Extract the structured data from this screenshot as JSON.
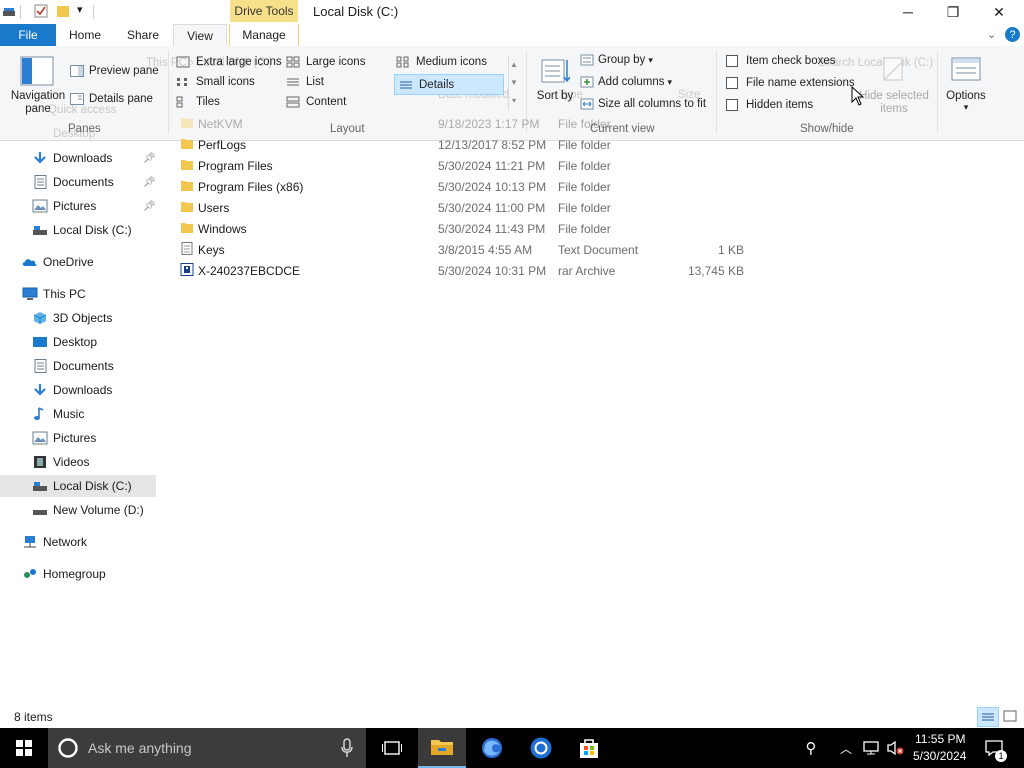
{
  "window": {
    "title": "Local Disk (C:)",
    "context_tab": "Drive Tools",
    "minimize_glyph": "─",
    "restore_glyph": "❐",
    "close_glyph": "✕"
  },
  "ribbon_tabs": {
    "file": "File",
    "home": "Home",
    "share": "Share",
    "view": "View",
    "manage": "Manage"
  },
  "ribbon": {
    "panes": {
      "navigation_pane": "Navigation pane",
      "preview_pane": "Preview pane",
      "details_pane": "Details pane",
      "group_label": "Panes"
    },
    "layout": {
      "extra_large_icons": "Extra large icons",
      "large_icons": "Large icons",
      "medium_icons": "Medium icons",
      "small_icons": "Small icons",
      "list": "List",
      "details": "Details",
      "tiles": "Tiles",
      "content": "Content",
      "group_label": "Layout"
    },
    "current_view": {
      "sort_by": "Sort by",
      "group_by": "Group by",
      "add_columns": "Add columns",
      "size_all_columns": "Size all columns to fit",
      "group_label": "Current view"
    },
    "show_hide": {
      "item_check_boxes": "Item check boxes",
      "file_name_extensions": "File name extensions",
      "hidden_items": "Hidden items",
      "hide_selected_items": "Hide selected items",
      "group_label": "Show/hide"
    },
    "options": "Options",
    "ghost": {
      "address": "This PC › Local Disk (C:)",
      "search": "Search Local Disk (C:)",
      "quick_access": "Quick access",
      "desktop": "Desktop",
      "col_date": "Date modified",
      "col_type": "Type",
      "col_size": "Size"
    }
  },
  "nav": {
    "quick_access": [
      {
        "label": "Downloads",
        "icon": "download-arrow-icon",
        "pinned": true
      },
      {
        "label": "Documents",
        "icon": "documents-icon",
        "pinned": true
      },
      {
        "label": "Pictures",
        "icon": "pictures-icon",
        "pinned": true
      },
      {
        "label": "Local Disk (C:)",
        "icon": "drive-icon",
        "pinned": false
      }
    ],
    "onedrive": "OneDrive",
    "this_pc": "This PC",
    "this_pc_items": [
      {
        "label": "3D Objects",
        "icon": "cube-icon"
      },
      {
        "label": "Desktop",
        "icon": "desktop-icon"
      },
      {
        "label": "Documents",
        "icon": "documents-icon"
      },
      {
        "label": "Downloads",
        "icon": "download-arrow-icon"
      },
      {
        "label": "Music",
        "icon": "music-note-icon"
      },
      {
        "label": "Pictures",
        "icon": "pictures-icon"
      },
      {
        "label": "Videos",
        "icon": "film-icon"
      },
      {
        "label": "Local Disk (C:)",
        "icon": "drive-icon",
        "selected": true
      },
      {
        "label": "New Volume (D:)",
        "icon": "drive-icon"
      }
    ],
    "network": "Network",
    "homegroup": "Homegroup"
  },
  "files": [
    {
      "name": "NetKVM",
      "date": "9/18/2023 1:17 PM",
      "type": "File folder",
      "size": "",
      "icon": "folder-icon",
      "faded": true
    },
    {
      "name": "PerfLogs",
      "date": "12/13/2017 8:52 PM",
      "type": "File folder",
      "size": "",
      "icon": "folder-icon"
    },
    {
      "name": "Program Files",
      "date": "5/30/2024 11:21 PM",
      "type": "File folder",
      "size": "",
      "icon": "folder-icon"
    },
    {
      "name": "Program Files (x86)",
      "date": "5/30/2024 10:13 PM",
      "type": "File folder",
      "size": "",
      "icon": "folder-icon"
    },
    {
      "name": "Users",
      "date": "5/30/2024 11:00 PM",
      "type": "File folder",
      "size": "",
      "icon": "folder-icon"
    },
    {
      "name": "Windows",
      "date": "5/30/2024 11:43 PM",
      "type": "File folder",
      "size": "",
      "icon": "folder-icon"
    },
    {
      "name": "Keys",
      "date": "3/8/2015 4:55 AM",
      "type": "Text Document",
      "size": "1 KB",
      "icon": "text-document-icon"
    },
    {
      "name": "X-240237EBCDCE",
      "date": "5/30/2024 10:31 PM",
      "type": "rar Archive",
      "size": "13,745 KB",
      "icon": "archive-icon"
    }
  ],
  "status": {
    "item_count": "8 items"
  },
  "taskbar": {
    "search_placeholder": "Ask me anything",
    "time": "11:55 PM",
    "date": "5/30/2024",
    "notification_count": "1"
  },
  "colors": {
    "accent": "#1979ca",
    "drive_tools_tab": "#f6e08a",
    "folder": "#f3c74e",
    "selection": "#cce8ff",
    "taskbar": "#000000"
  }
}
